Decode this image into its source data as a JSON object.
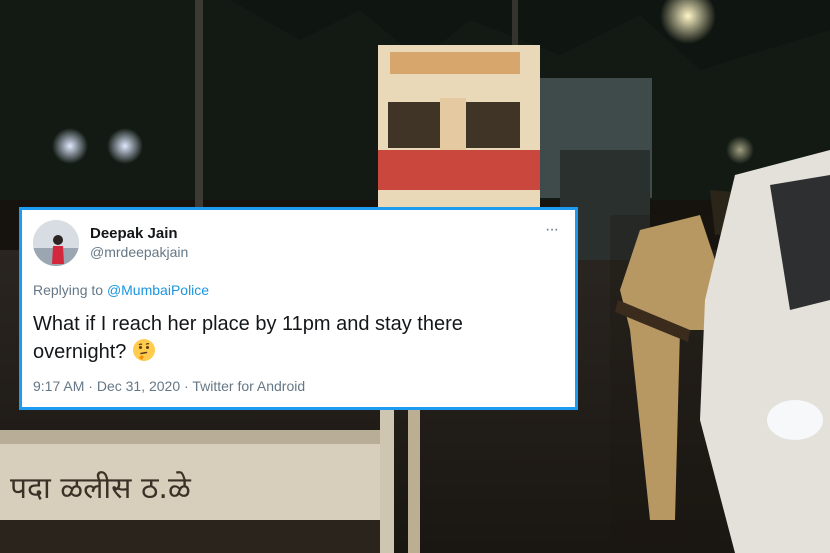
{
  "tweet": {
    "display_name": "Deepak Jain",
    "handle": "@mrdeepakjain",
    "reply_prefix": "Replying to",
    "reply_mention": "@MumbaiPolice",
    "text": "What if I reach her place by 11pm and stay there overnight?",
    "emoji": "thinking-face-emoji",
    "more_icon": "more-options-icon",
    "time": "9:17 AM",
    "date": "Dec 31, 2020",
    "source": "Twitter for Android",
    "separator": "·",
    "more_glyph": "···"
  },
  "background": {
    "barricade_text": "पदा ळलीस ठ.ळे"
  },
  "colors": {
    "accent_border": "#1d9bf0",
    "mention": "#1b95e0",
    "primary_text": "#14171a",
    "secondary_text": "#657786"
  }
}
